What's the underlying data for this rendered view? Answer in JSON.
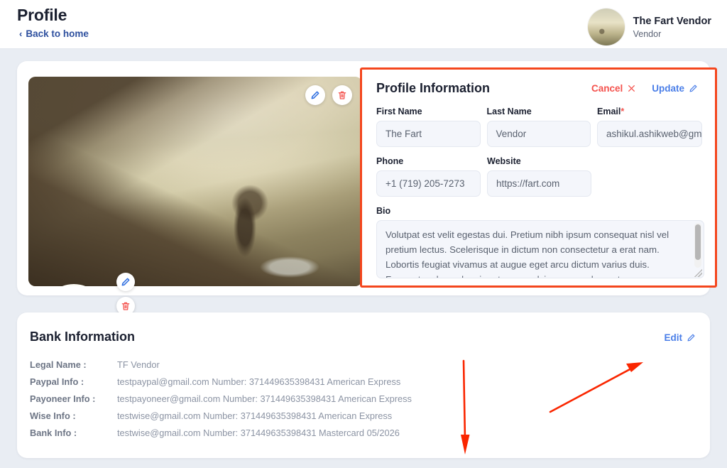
{
  "header": {
    "title": "Profile",
    "back_label": "Back to home",
    "back_chevron": "chevron-left-icon",
    "user": {
      "name": "The Fart Vendor",
      "role": "Vendor"
    }
  },
  "profile": {
    "cover_actions": [
      {
        "name": "edit-cover-button",
        "icon": "pencil-icon"
      },
      {
        "name": "delete-cover-button",
        "icon": "trash-icon"
      }
    ],
    "avatar_actions": [
      {
        "name": "edit-avatar-button",
        "icon": "pencil-icon"
      },
      {
        "name": "delete-avatar-button",
        "icon": "trash-icon"
      }
    ],
    "form": {
      "title": "Profile Information",
      "cancel_label": "Cancel",
      "cancel_icon": "close-icon",
      "update_label": "Update",
      "update_icon": "pencil-icon",
      "fields": {
        "first_name": {
          "label": "First Name",
          "value": "The Fart"
        },
        "last_name": {
          "label": "Last Name",
          "value": "Vendor"
        },
        "email": {
          "label": "Email",
          "required": "*",
          "value": "ashikul.ashikweb@gma"
        },
        "phone": {
          "label": "Phone",
          "value": "+1 (719) 205-7273"
        },
        "website": {
          "label": "Website",
          "value": "https://fart.com"
        },
        "bio": {
          "label": "Bio",
          "value": "Volutpat est velit egestas dui. Pretium nibh ipsum consequat nisl vel pretium lectus. Scelerisque in dictum non consectetur a erat nam. Lobortis feugiat vivamus at augue eget arcu dictum varius duis. Fermentum leo vel orci porta non pulvinar neque laoreet."
        }
      }
    }
  },
  "bank": {
    "title": "Bank Information",
    "edit_label": "Edit",
    "edit_icon": "pencil-icon",
    "rows": [
      {
        "key": "Legal Name :",
        "value": "TF Vendor"
      },
      {
        "key": "Paypal Info :",
        "value": "testpaypal@gmail.com Number: 371449635398431 American Express"
      },
      {
        "key": "Payoneer Info :",
        "value": "testpayoneer@gmail.com Number: 371449635398431 American Express"
      },
      {
        "key": "Wise Info :",
        "value": "testwise@gmail.com Number: 371449635398431 American Express"
      },
      {
        "key": "Bank Info :",
        "value": "testwise@gmail.com Number: 371449635398431 Mastercard 05/2026"
      }
    ]
  },
  "annotations": {
    "highlight_color": "#f4461d",
    "arrow_color": "#fa2600",
    "shapes": [
      {
        "name": "highlight-box-profile-form"
      },
      {
        "name": "arrow-down"
      },
      {
        "name": "arrow-up-right"
      }
    ]
  },
  "colors": {
    "page_bg": "#e9edf3",
    "card_bg": "#ffffff",
    "accent_blue": "#4a7ee8",
    "accent_red": "#f4524d",
    "link_blue": "#2d4f9e",
    "input_bg": "#f4f6fb",
    "text_dark": "#1b2030",
    "text_muted": "#8b93a3"
  }
}
